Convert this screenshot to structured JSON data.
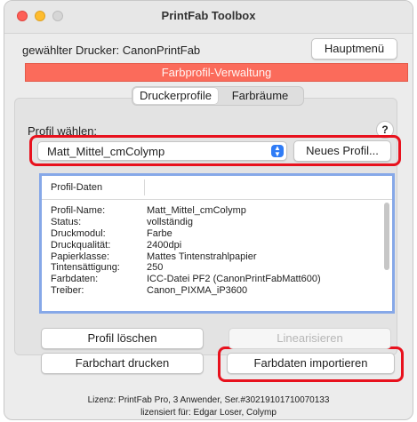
{
  "window": {
    "title": "PrintFab Toolbox"
  },
  "header": {
    "printer_label": "gewählter Drucker: CanonPrintFab",
    "main_menu_label": "Hauptmenü"
  },
  "banner": {
    "text": "Farbprofil-Verwaltung",
    "color": "#fb6b5b"
  },
  "tabs": [
    {
      "label": "Druckerprofile",
      "active": true
    },
    {
      "label": "Farbräume",
      "active": false
    }
  ],
  "profile_select": {
    "label": "Profil wählen:",
    "help": "?",
    "value": "Matt_Mittel_cmColymp",
    "new_profile_label": "Neues Profil..."
  },
  "profile_data": {
    "header": "Profil-Daten",
    "rows": [
      {
        "key": "Profil-Name:",
        "value": "Matt_Mittel_cmColymp"
      },
      {
        "key": "Status:",
        "value": "vollständig"
      },
      {
        "key": "Druckmodul:",
        "value": "Farbe"
      },
      {
        "key": "Druckqualität:",
        "value": "2400dpi"
      },
      {
        "key": "Papierklasse:",
        "value": "Mattes Tintenstrahlpapier"
      },
      {
        "key": "Tintensättigung:",
        "value": "250"
      },
      {
        "key": "Farbdaten:",
        "value": "ICC-Datei PF2 (CanonPrintFabMatt600)"
      },
      {
        "key": "Treiber:",
        "value": "Canon_PIXMA_iP3600"
      }
    ]
  },
  "actions": {
    "delete_profile": "Profil löschen",
    "linearize": "Linearisieren",
    "print_chart": "Farbchart drucken",
    "import_color_data": "Farbdaten importieren"
  },
  "footer": {
    "license": "Lizenz: PrintFab Pro, 3 Anwender, Ser.#30219101710070133",
    "licensed_to": "lizensiert für: Edgar Loser, Colymp"
  },
  "highlight_color": "#e8111d"
}
